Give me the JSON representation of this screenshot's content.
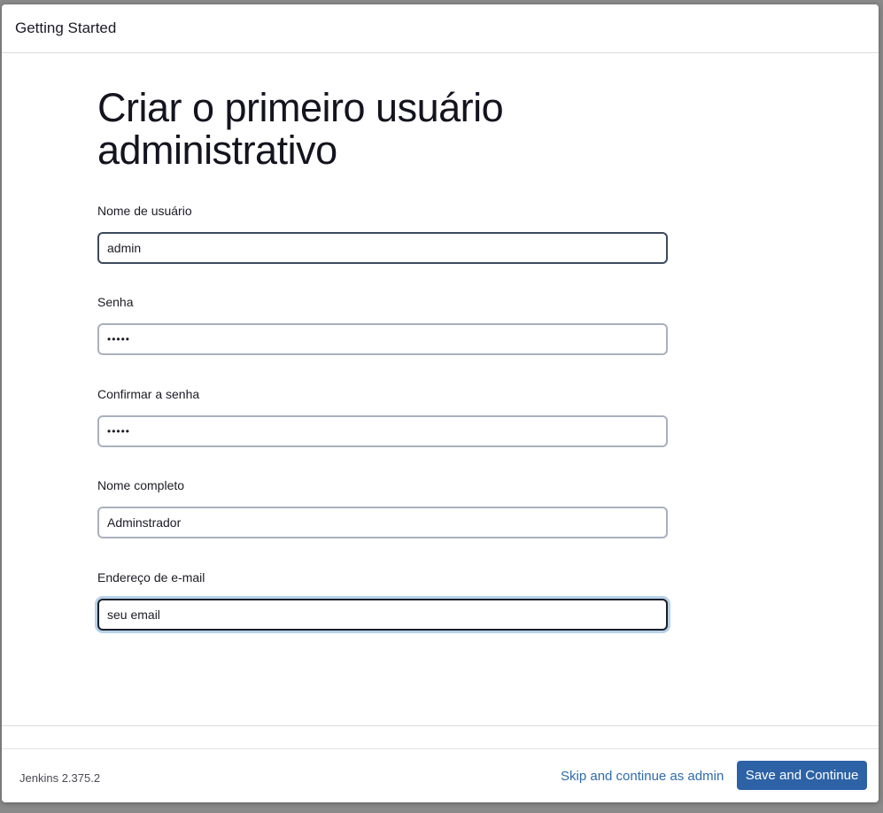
{
  "header": {
    "title": "Getting Started"
  },
  "main": {
    "heading": "Criar o primeiro usuário administrativo",
    "fields": [
      {
        "label": "Nome de usuário",
        "value": "admin",
        "type": "text"
      },
      {
        "label": "Senha",
        "value": "•••••",
        "type": "password"
      },
      {
        "label": "Confirmar a senha",
        "value": "•••••",
        "type": "password"
      },
      {
        "label": "Nome completo",
        "value": "Adminstrador",
        "type": "text"
      },
      {
        "label": "Endereço de e-mail",
        "value": "seu email",
        "type": "text",
        "focused": true
      }
    ]
  },
  "footer": {
    "version": "Jenkins 2.375.2",
    "skip_label": "Skip and continue as admin",
    "save_label": "Save and Continue"
  },
  "colors": {
    "primary_button": "#2d63a6",
    "link": "#2f6bac",
    "focus_ring": "#b7d2e9"
  }
}
